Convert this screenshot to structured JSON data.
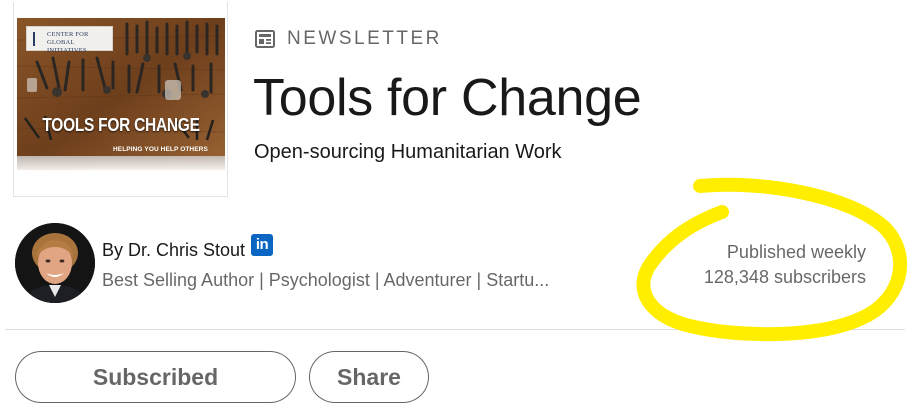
{
  "cover": {
    "logo_text_line1": "Center for",
    "logo_text_line2": "Global Initiatives",
    "title": "TOOLS FOR CHANGE",
    "subtitle": "Helping you help others"
  },
  "newsletter": {
    "label": "NEWSLETTER",
    "icon": "newsletter-icon",
    "title": "Tools for Change",
    "description": "Open-sourcing Humanitarian Work"
  },
  "author": {
    "by": "By",
    "name": "Dr. Chris Stout",
    "badge_icon": "linkedin-icon",
    "badge_text": "in",
    "headline": "Best Selling Author | Psychologist | Adventurer | Startu..."
  },
  "publication": {
    "frequency": "Published weekly",
    "subscribers": "128,348 subscribers"
  },
  "actions": {
    "subscribed_label": "Subscribed",
    "share_label": "Share"
  },
  "colors": {
    "highlight": "#ffee00",
    "linkedin_blue": "#0a66c2"
  }
}
